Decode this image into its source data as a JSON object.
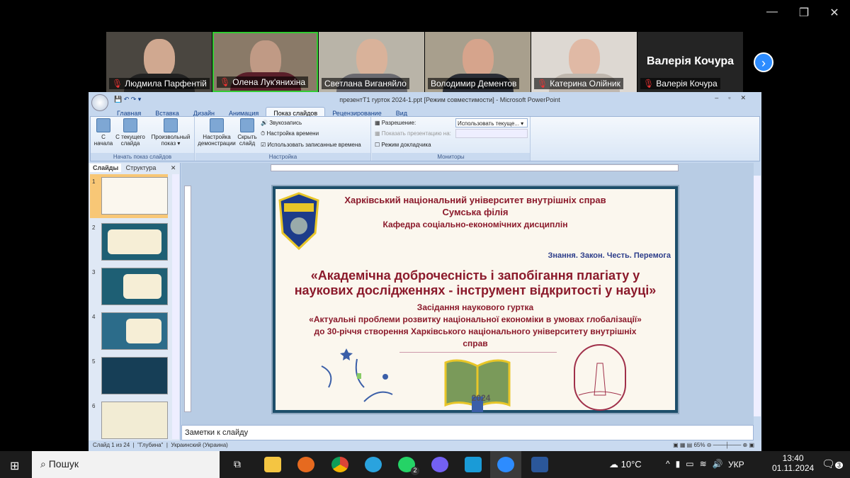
{
  "participants": [
    {
      "name": "Людмила Парфентій",
      "muted": true
    },
    {
      "name": "Олена Лук'янихіна",
      "muted": true,
      "active": true
    },
    {
      "name": "Светлана Виганяйло",
      "muted": false
    },
    {
      "name": "Володимир Дементов",
      "muted": false
    },
    {
      "name": "Катерина Олійник",
      "muted": true
    },
    {
      "name": "Валерія Кочура",
      "muted": true,
      "no_video": true
    }
  ],
  "ppt": {
    "title": "презентТ1 гурток 2024-1.ppt [Режим совместимости] - Microsoft PowerPoint",
    "tabs": [
      "Главная",
      "Вставка",
      "Дизайн",
      "Анимация",
      "Показ слайдов",
      "Рецензирование",
      "Вид"
    ],
    "groups": {
      "start": {
        "label": "Начать показ слайдов",
        "b1": "С начала",
        "b2": "С текущего слайда",
        "b3": "Произвольный показ ▾"
      },
      "setup": {
        "label": "Настройка",
        "b1": "Настройка демонстрации",
        "b2": "Скрыть слайд",
        "s1": "Звукозапись",
        "s2": "Настройка времени",
        "s3": "Использовать записанные времена"
      },
      "monitors": {
        "label": "Мониторы",
        "s1": "Разрешение:",
        "v1": "Использовать текуще...",
        "s2": "Показать презентацию на:",
        "s3": "Режим докладчика"
      }
    },
    "panel_tabs": [
      "Слайды",
      "Структура"
    ],
    "slide_numbers": [
      "1",
      "2",
      "3",
      "4",
      "5",
      "6"
    ],
    "notes_placeholder": "Заметки к слайду",
    "status": {
      "slide": "Слайд 1 из 24",
      "theme": "\"Глубина\"",
      "lang": "Украинский (Украина)",
      "zoom": "65%"
    }
  },
  "slide": {
    "l1": "Харківський національний університет внутрішніх справ",
    "l2": "Сумська філія",
    "l3": "Кафедра соціально-економічних дисциплін",
    "motto": "Знання. Закон. Честь. Перемога",
    "title1": "«Академічна доброчесність і запобігання плагіату у",
    "title2": "наукових дослідженнях - інструмент відкритості у науці»",
    "s1": "Засідання наукового гуртка",
    "s2": "«Актуальні проблеми розвитку національної  економіки в умовах глобалізації»",
    "s3": "до 30-річчя  створення Харківського національного університету внутрішніх",
    "s4": "справ",
    "year": "2024"
  },
  "taskbar": {
    "search": "Пошук",
    "weather": "10°C",
    "lang": "УКР",
    "time": "13:40",
    "date": "01.11.2024",
    "whatsapp_badge": "2",
    "notif_badge": "3"
  }
}
